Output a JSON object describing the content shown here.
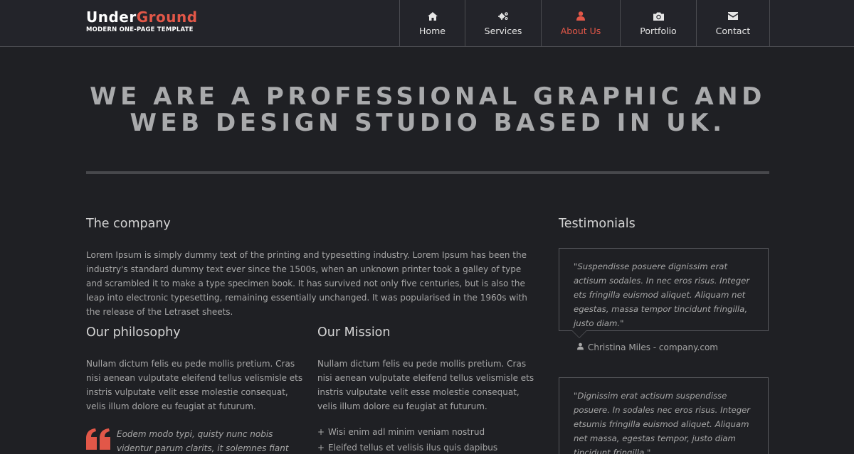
{
  "brand": {
    "title_part1": "Under",
    "title_part2": "Ground",
    "subtitle": "MODERN ONE-PAGE TEMPLATE",
    "accent_color": "#e25748"
  },
  "nav": [
    {
      "label": "Home",
      "icon": "home-icon",
      "active": false
    },
    {
      "label": "Services",
      "icon": "gears-icon",
      "active": false
    },
    {
      "label": "About Us",
      "icon": "user-icon",
      "active": true
    },
    {
      "label": "Portfolio",
      "icon": "camera-icon",
      "active": false
    },
    {
      "label": "Contact",
      "icon": "envelope-icon",
      "active": false
    }
  ],
  "hero": {
    "line1": "WE ARE A PROFESSIONAL GRAPHIC AND",
    "line2": "WEB DESIGN STUDIO BASED IN UK."
  },
  "company": {
    "heading": "The company",
    "text": "Lorem Ipsum is simply dummy text of the printing and typesetting industry. Lorem Ipsum has been the industry's standard dummy text ever since the 1500s, when an unknown printer took a galley of type and scrambled it to make a type specimen book. It has survived not only five centuries, but is also the leap into electronic typesetting, remaining essentially unchanged. It was popularised in the 1960s with the release of the Letraset sheets."
  },
  "philosophy": {
    "heading": "Our philosophy",
    "text": "Nullam dictum felis eu pede mollis pretium. Cras nisi aenean vulputate eleifend tellus velismisle ets instris vulputate velit esse molestie consequat, velis illum dolore eu feugiat at futurum.",
    "quote": "Eodem modo typi, quisty nunc nobis videntur parum clarits, it solemnes fiant futurum laris"
  },
  "mission": {
    "heading": "Our Mission",
    "text": "Nullam dictum felis eu pede mollis pretium. Cras nisi aenean vulputate eleifend tellus velismisle ets instris vulputate velit esse molestie consequat, velis illum dolore eu feugiat at futurum.",
    "items": [
      "Wisi enim adl minim veniam nostrud",
      "Eleifed tellus et velisis ilus quis dapibus"
    ]
  },
  "testimonials": {
    "heading": "Testimonials",
    "items": [
      {
        "quote": "\"Suspendisse posuere dignissim erat actisum sodales. In nec eros risus. Integer ets fringilla euismod aliquet. Aliquam net egestas, massa tempor tincidunt fringilla, justo diam.\"",
        "author": "Christina Miles - company.com"
      },
      {
        "quote": "\"Dignissim erat actisum suspendisse posuere. In sodales nec eros risus. Integer etsumis fringilla euismod aliquet. Aliquam net massa, egestas tempor, justo diam tincidunt fringilla.\""
      }
    ]
  }
}
